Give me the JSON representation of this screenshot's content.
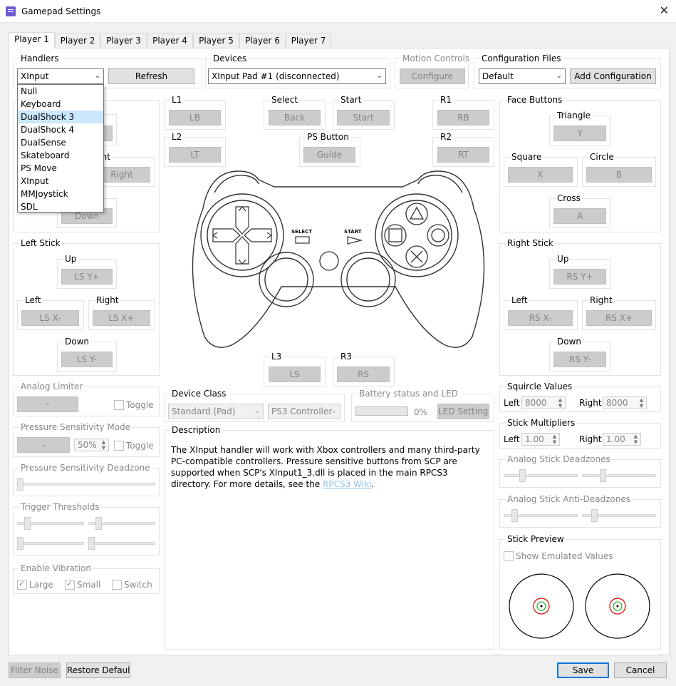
{
  "window": {
    "title": "Gamepad Settings",
    "close_glyph": "✕"
  },
  "tabs": [
    {
      "label": "Player 1"
    },
    {
      "label": "Player 2"
    },
    {
      "label": "Player 3"
    },
    {
      "label": "Player 4"
    },
    {
      "label": "Player 5"
    },
    {
      "label": "Player 6"
    },
    {
      "label": "Player 7"
    }
  ],
  "handlers": {
    "title": "Handlers",
    "selected": "XInput",
    "refresh_label": "Refresh",
    "options": [
      "Null",
      "Keyboard",
      "DualShock 3",
      "DualShock 4",
      "DualSense",
      "Skateboard",
      "PS Move",
      "XInput",
      "MMJoystick",
      "SDL"
    ],
    "highlighted": "DualShock 3"
  },
  "devices": {
    "title": "Devices",
    "selected": "XInput Pad #1 (disconnected)"
  },
  "motion": {
    "title": "Motion Controls",
    "configure_label": "Configure"
  },
  "config_files": {
    "title": "Configuration Files",
    "selected": "Default",
    "add_label": "Add Configuration"
  },
  "dpad": {
    "right_title_partial": "ght",
    "right_label": "Right",
    "down_label": "Down"
  },
  "shoulders": {
    "l1": {
      "title": "L1",
      "label": "LB"
    },
    "l2": {
      "title": "L2",
      "label": "LT"
    },
    "r1": {
      "title": "R1",
      "label": "RB"
    },
    "r2": {
      "title": "R2",
      "label": "RT"
    },
    "select": {
      "title": "Select",
      "label": "Back"
    },
    "start": {
      "title": "Start",
      "label": "Start"
    },
    "ps": {
      "title": "PS Button",
      "label": "Guide"
    }
  },
  "face": {
    "title": "Face Buttons",
    "triangle": {
      "title": "Triangle",
      "label": "Y"
    },
    "square": {
      "title": "Square",
      "label": "X"
    },
    "circle": {
      "title": "Circle",
      "label": "B"
    },
    "cross": {
      "title": "Cross",
      "label": "A"
    }
  },
  "left_stick": {
    "title": "Left Stick",
    "up": {
      "title": "Up",
      "label": "LS Y+"
    },
    "left": {
      "title": "Left",
      "label": "LS X-"
    },
    "right": {
      "title": "Right",
      "label": "LS X+"
    },
    "down": {
      "title": "Down",
      "label": "LS Y-"
    }
  },
  "right_stick": {
    "title": "Right Stick",
    "up": {
      "title": "Up",
      "label": "RS Y+"
    },
    "left": {
      "title": "Left",
      "label": "RS X-"
    },
    "right": {
      "title": "Right",
      "label": "RS X+"
    },
    "down": {
      "title": "Down",
      "label": "RS Y-"
    }
  },
  "l3": {
    "title": "L3",
    "label": "LS"
  },
  "r3": {
    "title": "R3",
    "label": "RS"
  },
  "controller_labels": {
    "select": "SELECT",
    "start": "START"
  },
  "analog_limiter": {
    "title": "Analog Limiter",
    "button": "-",
    "toggle": "Toggle"
  },
  "pressure_mode": {
    "title": "Pressure Sensitivity Mode",
    "button": "-",
    "value": "50%",
    "toggle": "Toggle"
  },
  "pressure_deadzone": {
    "title": "Pressure Sensitivity Deadzone"
  },
  "trigger_thresholds": {
    "title": "Trigger Thresholds"
  },
  "vibration": {
    "title": "Enable Vibration",
    "large": "Large",
    "small": "Small",
    "switch": "Switch"
  },
  "device_class": {
    "title": "Device Class",
    "class": "Standard (Pad)",
    "type": "PS3 Controller"
  },
  "battery": {
    "title": "Battery status and LED",
    "percent": "0%",
    "led_label": "LED Settings",
    "level": 0
  },
  "description": {
    "title": "Description",
    "text": "The XInput handler will work with Xbox controllers and many third-party PC-compatible controllers. Pressure sensitive buttons from SCP are supported when SCP's XInput1_3.dll is placed in the main RPCS3 directory. For more details, see the ",
    "link": "RPCS3 Wiki",
    "end": "."
  },
  "squircle": {
    "title": "Squircle Values",
    "left_label": "Left",
    "left_value": "8000",
    "right_label": "Right",
    "right_value": "8000"
  },
  "multipliers": {
    "title": "Stick Multipliers",
    "left_label": "Left",
    "left_value": "1.00",
    "right_label": "Right",
    "right_value": "1.00"
  },
  "deadzones": {
    "title": "Analog Stick Deadzones"
  },
  "anti_deadzones": {
    "title": "Analog Stick Anti-Deadzones"
  },
  "stick_preview": {
    "title": "Stick Preview",
    "show_emulated": "Show Emulated Values"
  },
  "bottom": {
    "filter_noise": "Filter Noise",
    "restore": "Restore Defaults",
    "save": "Save",
    "cancel": "Cancel"
  },
  "colors": {
    "accent": "#0078d7",
    "dropdown_highlight": "#cce8ff",
    "link": "#8fc2e8",
    "preview_outer": "#e00000",
    "preview_inner": "#00a000"
  }
}
